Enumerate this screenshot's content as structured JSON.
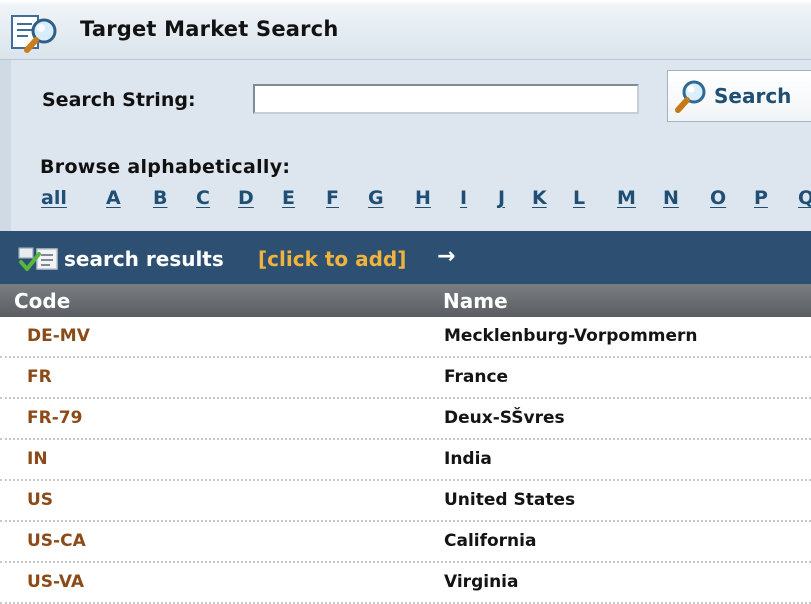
{
  "header": {
    "title": "Target Market Search",
    "icon": "search-document-icon"
  },
  "search": {
    "label": "Search String:",
    "value": "",
    "placeholder": "",
    "button_label": "Search",
    "button_icon": "magnifier-icon"
  },
  "browse": {
    "label": "Browse alphabetically:",
    "letters": [
      "all",
      "A",
      "B",
      "C",
      "D",
      "E",
      "F",
      "G",
      "H",
      "I",
      "J",
      "K",
      "L",
      "M",
      "N",
      "O",
      "P",
      "Q"
    ]
  },
  "results": {
    "title": "search results",
    "add_label": "[click to add]",
    "arrow": "→",
    "icon": "checked-list-icon"
  },
  "table": {
    "columns": [
      "Code",
      "Name"
    ],
    "rows": [
      {
        "code": "DE-MV",
        "name": "Mecklenburg-Vorpommern"
      },
      {
        "code": "FR",
        "name": "France"
      },
      {
        "code": "FR-79",
        "name": "Deux-SŠvres"
      },
      {
        "code": "IN",
        "name": "India"
      },
      {
        "code": "US",
        "name": "United States"
      },
      {
        "code": "US-CA",
        "name": "California"
      },
      {
        "code": "US-VA",
        "name": "Virginia"
      }
    ]
  },
  "colors": {
    "header_bar": "#2d4f72",
    "link": "#1f4f74",
    "code_text": "#8b4a18",
    "add_link": "#f0b43c",
    "panel_bg": "#dde6ee"
  }
}
